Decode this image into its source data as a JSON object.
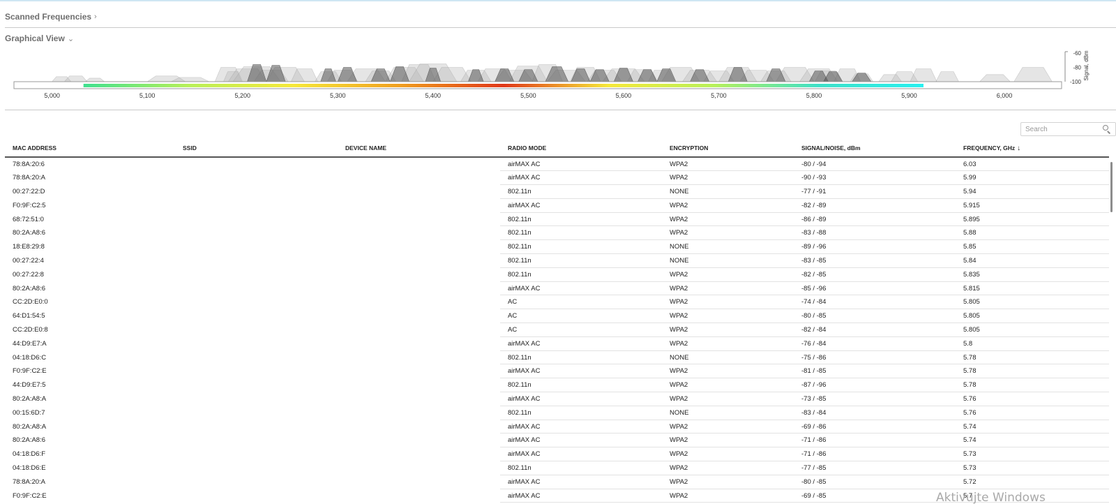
{
  "header": {
    "scanned_title": "Scanned Frequencies",
    "scanned_chevron": "›",
    "graphical_title": "Graphical View",
    "graphical_chevron": "⌄"
  },
  "chart_data": {
    "type": "area",
    "xlim": [
      4960,
      6060
    ],
    "xticks": [
      "5,000",
      "5,100",
      "5,200",
      "5,300",
      "5,400",
      "5,500",
      "5,600",
      "5,700",
      "5,800",
      "5,900",
      "6,000"
    ],
    "xtick_values": [
      5000,
      5100,
      5200,
      5300,
      5400,
      5500,
      5600,
      5700,
      5800,
      5900,
      6000
    ],
    "ylim": [
      -100,
      -55
    ],
    "yticks": [
      "-60",
      "-80",
      "-100"
    ],
    "ytick_values": [
      -60,
      -80,
      -100
    ],
    "ylabel": "Signal, dBm",
    "heatbar_range": [
      5033,
      5915
    ],
    "heatbar_colors": [
      "#3fe08f",
      "#b8f05a",
      "#f6e83a",
      "#f0a020",
      "#e03818",
      "#f6e83a",
      "#b8f05a",
      "#3fe0c8",
      "#2af0f0"
    ],
    "signals": [
      {
        "f": 5010,
        "w": 10,
        "s": -93
      },
      {
        "f": 5025,
        "w": 12,
        "s": -92
      },
      {
        "f": 5045,
        "w": 10,
        "s": -95
      },
      {
        "f": 5120,
        "w": 20,
        "s": -92
      },
      {
        "f": 5145,
        "w": 20,
        "s": -94
      },
      {
        "f": 5185,
        "w": 14,
        "s": -80
      },
      {
        "f": 5190,
        "w": 10,
        "s": -86
      },
      {
        "f": 5205,
        "w": 20,
        "s": -82
      },
      {
        "f": 5215,
        "w": 25,
        "s": -79
      },
      {
        "f": 5230,
        "w": 18,
        "s": -84
      },
      {
        "f": 5245,
        "w": 20,
        "s": -80
      },
      {
        "f": 5265,
        "w": 14,
        "s": -82
      },
      {
        "f": 5290,
        "w": 14,
        "s": -86
      },
      {
        "f": 5305,
        "w": 16,
        "s": -84
      },
      {
        "f": 5330,
        "w": 20,
        "s": -82
      },
      {
        "f": 5345,
        "w": 16,
        "s": -85
      },
      {
        "f": 5370,
        "w": 20,
        "s": -80
      },
      {
        "f": 5385,
        "w": 18,
        "s": -76
      },
      {
        "f": 5400,
        "w": 25,
        "s": -75
      },
      {
        "f": 5420,
        "w": 20,
        "s": -80
      },
      {
        "f": 5445,
        "w": 16,
        "s": -84
      },
      {
        "f": 5465,
        "w": 18,
        "s": -82
      },
      {
        "f": 5485,
        "w": 20,
        "s": -84
      },
      {
        "f": 5500,
        "w": 20,
        "s": -78
      },
      {
        "f": 5520,
        "w": 16,
        "s": -76
      },
      {
        "f": 5540,
        "w": 20,
        "s": -84
      },
      {
        "f": 5560,
        "w": 16,
        "s": -80
      },
      {
        "f": 5580,
        "w": 18,
        "s": -84
      },
      {
        "f": 5600,
        "w": 22,
        "s": -82
      },
      {
        "f": 5620,
        "w": 16,
        "s": -83
      },
      {
        "f": 5640,
        "w": 14,
        "s": -84
      },
      {
        "f": 5660,
        "w": 20,
        "s": -80
      },
      {
        "f": 5680,
        "w": 18,
        "s": -84
      },
      {
        "f": 5700,
        "w": 16,
        "s": -85
      },
      {
        "f": 5720,
        "w": 20,
        "s": -80
      },
      {
        "f": 5740,
        "w": 18,
        "s": -84
      },
      {
        "f": 5760,
        "w": 16,
        "s": -85
      },
      {
        "f": 5780,
        "w": 20,
        "s": -80
      },
      {
        "f": 5805,
        "w": 20,
        "s": -82
      },
      {
        "f": 5815,
        "w": 14,
        "s": -85
      },
      {
        "f": 5835,
        "w": 14,
        "s": -82
      },
      {
        "f": 5850,
        "w": 12,
        "s": -89
      },
      {
        "f": 5880,
        "w": 12,
        "s": -90
      },
      {
        "f": 5895,
        "w": 14,
        "s": -86
      },
      {
        "f": 5915,
        "w": 14,
        "s": -82
      },
      {
        "f": 5940,
        "w": 12,
        "s": -86
      },
      {
        "f": 5990,
        "w": 16,
        "s": -90
      },
      {
        "f": 6030,
        "w": 20,
        "s": -80
      }
    ],
    "dark_signals": [
      {
        "f": 5215,
        "w": 10,
        "s": -76
      },
      {
        "f": 5235,
        "w": 10,
        "s": -77
      },
      {
        "f": 5290,
        "w": 8,
        "s": -82
      },
      {
        "f": 5310,
        "w": 10,
        "s": -80
      },
      {
        "f": 5345,
        "w": 10,
        "s": -82
      },
      {
        "f": 5365,
        "w": 10,
        "s": -79
      },
      {
        "f": 5400,
        "w": 8,
        "s": -81
      },
      {
        "f": 5445,
        "w": 8,
        "s": -83
      },
      {
        "f": 5475,
        "w": 10,
        "s": -82
      },
      {
        "f": 5500,
        "w": 10,
        "s": -83
      },
      {
        "f": 5530,
        "w": 12,
        "s": -79
      },
      {
        "f": 5555,
        "w": 10,
        "s": -82
      },
      {
        "f": 5575,
        "w": 10,
        "s": -83
      },
      {
        "f": 5600,
        "w": 10,
        "s": -81
      },
      {
        "f": 5625,
        "w": 10,
        "s": -83
      },
      {
        "f": 5645,
        "w": 10,
        "s": -82
      },
      {
        "f": 5680,
        "w": 10,
        "s": -83
      },
      {
        "f": 5720,
        "w": 10,
        "s": -80
      },
      {
        "f": 5760,
        "w": 10,
        "s": -82
      },
      {
        "f": 5805,
        "w": 10,
        "s": -85
      },
      {
        "f": 5820,
        "w": 10,
        "s": -86
      },
      {
        "f": 5850,
        "w": 10,
        "s": -88
      }
    ]
  },
  "search": {
    "placeholder": "Search"
  },
  "table": {
    "headers": [
      "MAC ADDRESS",
      "SSID",
      "DEVICE NAME",
      "RADIO MODE",
      "ENCRYPTION",
      "SIGNAL/NOISE, dBm",
      "FREQUENCY, GHz"
    ],
    "sort_indicator": "↓",
    "rows": [
      {
        "mac": "78:8A:20:6",
        "ssid": "",
        "device": "",
        "mode": "airMAX AC",
        "enc": "WPA2",
        "sn": "-80 / -94",
        "freq": "6.03"
      },
      {
        "mac": "78:8A:20:A",
        "ssid": "",
        "device": "",
        "mode": "airMAX AC",
        "enc": "WPA2",
        "sn": "-90 / -93",
        "freq": "5.99"
      },
      {
        "mac": "00:27:22:D",
        "ssid": "",
        "device": "",
        "mode": "802.11n",
        "enc": "NONE",
        "sn": "-77 / -91",
        "freq": "5.94"
      },
      {
        "mac": "F0:9F:C2:5",
        "ssid": "",
        "device": "",
        "mode": "airMAX AC",
        "enc": "WPA2",
        "sn": "-82 / -89",
        "freq": "5.915"
      },
      {
        "mac": "68:72:51:0",
        "ssid": "",
        "device": "",
        "mode": "802.11n",
        "enc": "WPA2",
        "sn": "-86 / -89",
        "freq": "5.895"
      },
      {
        "mac": "80:2A:A8:6",
        "ssid": "",
        "device": "",
        "mode": "802.11n",
        "enc": "WPA2",
        "sn": "-83 / -88",
        "freq": "5.88"
      },
      {
        "mac": "18:E8:29:8",
        "ssid": "",
        "device": "",
        "mode": "802.11n",
        "enc": "NONE",
        "sn": "-89 / -96",
        "freq": "5.85"
      },
      {
        "mac": "00:27:22:4",
        "ssid": "",
        "device": "",
        "mode": "802.11n",
        "enc": "NONE",
        "sn": "-83 / -85",
        "freq": "5.84"
      },
      {
        "mac": "00:27:22:8",
        "ssid": "",
        "device": "",
        "mode": "802.11n",
        "enc": "WPA2",
        "sn": "-82 / -85",
        "freq": "5.835"
      },
      {
        "mac": "80:2A:A8:6",
        "ssid": "",
        "device": "",
        "mode": "airMAX AC",
        "enc": "WPA2",
        "sn": "-85 / -96",
        "freq": "5.815"
      },
      {
        "mac": "CC:2D:E0:0",
        "ssid": "",
        "device": "",
        "mode": "AC",
        "enc": "WPA2",
        "sn": "-74 / -84",
        "freq": "5.805"
      },
      {
        "mac": "64:D1:54:5",
        "ssid": "",
        "device": "",
        "mode": "AC",
        "enc": "WPA2",
        "sn": "-80 / -85",
        "freq": "5.805"
      },
      {
        "mac": "CC:2D:E0:8",
        "ssid": "",
        "device": "",
        "mode": "AC",
        "enc": "WPA2",
        "sn": "-82 / -84",
        "freq": "5.805"
      },
      {
        "mac": "44:D9:E7:A",
        "ssid": "",
        "device": "",
        "mode": "airMAX AC",
        "enc": "WPA2",
        "sn": "-76 / -84",
        "freq": "5.8"
      },
      {
        "mac": "04:18:D6:C",
        "ssid": "",
        "device": "",
        "mode": "802.11n",
        "enc": "NONE",
        "sn": "-75 / -86",
        "freq": "5.78"
      },
      {
        "mac": "F0:9F:C2:E",
        "ssid": "",
        "device": "",
        "mode": "airMAX AC",
        "enc": "WPA2",
        "sn": "-81 / -85",
        "freq": "5.78"
      },
      {
        "mac": "44:D9:E7:5",
        "ssid": "",
        "device": "",
        "mode": "802.11n",
        "enc": "WPA2",
        "sn": "-87 / -96",
        "freq": "5.78"
      },
      {
        "mac": "80:2A:A8:A",
        "ssid": "",
        "device": "",
        "mode": "airMAX AC",
        "enc": "WPA2",
        "sn": "-73 / -85",
        "freq": "5.76"
      },
      {
        "mac": "00:15:6D:7",
        "ssid": "",
        "device": "",
        "mode": "802.11n",
        "enc": "NONE",
        "sn": "-83 / -84",
        "freq": "5.76"
      },
      {
        "mac": "80:2A:A8:A",
        "ssid": "",
        "device": "",
        "mode": "airMAX AC",
        "enc": "WPA2",
        "sn": "-69 / -86",
        "freq": "5.74"
      },
      {
        "mac": "80:2A:A8:6",
        "ssid": "",
        "device": "",
        "mode": "airMAX AC",
        "enc": "WPA2",
        "sn": "-71 / -86",
        "freq": "5.74"
      },
      {
        "mac": "04:18:D6:F",
        "ssid": "",
        "device": "",
        "mode": "airMAX AC",
        "enc": "WPA2",
        "sn": "-71 / -86",
        "freq": "5.73"
      },
      {
        "mac": "04:18:D6:E",
        "ssid": "",
        "device": "",
        "mode": "802.11n",
        "enc": "WPA2",
        "sn": "-77 / -85",
        "freq": "5.73"
      },
      {
        "mac": "78:8A:20:A",
        "ssid": "",
        "device": "",
        "mode": "airMAX AC",
        "enc": "WPA2",
        "sn": "-80 / -85",
        "freq": "5.72"
      },
      {
        "mac": "F0:9F:C2:E",
        "ssid": "",
        "device": "",
        "mode": "airMAX AC",
        "enc": "WPA2",
        "sn": "-69 / -85",
        "freq": "5.7"
      }
    ]
  },
  "watermark": "Aktivujte Windows"
}
